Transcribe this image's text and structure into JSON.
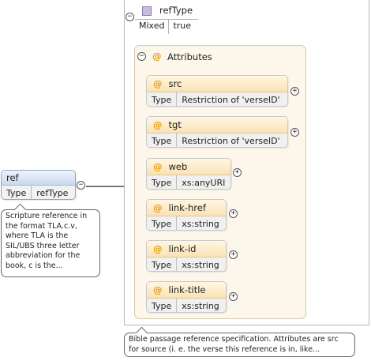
{
  "complex_type": {
    "name": "refType",
    "mixed_label": "Mixed",
    "mixed_value": "true"
  },
  "attributes_group": {
    "title": "Attributes",
    "at_symbol": "@",
    "toggle_symbol": "−"
  },
  "attributes": [
    {
      "name": "src",
      "type_label": "Type",
      "type_value": "Restriction of 'verseID'"
    },
    {
      "name": "tgt",
      "type_label": "Type",
      "type_value": "Restriction of 'verseID'"
    },
    {
      "name": "web",
      "type_label": "Type",
      "type_value": "xs:anyURI"
    },
    {
      "name": "link-href",
      "type_label": "Type",
      "type_value": "xs:string"
    },
    {
      "name": "link-id",
      "type_label": "Type",
      "type_value": "xs:string"
    },
    {
      "name": "link-title",
      "type_label": "Type",
      "type_value": "xs:string"
    }
  ],
  "expand_symbol": "+",
  "element": {
    "name": "ref",
    "type_label": "Type",
    "type_value": "refType",
    "doc": "Scripture reference in the format TLA.c.v, where TLA is the SIL/UBS three letter abbreviation for the book, c is the..."
  },
  "type_doc": "Bible passage reference specification. Attributes are src for source (i. e. the verse this reference is in, like..."
}
